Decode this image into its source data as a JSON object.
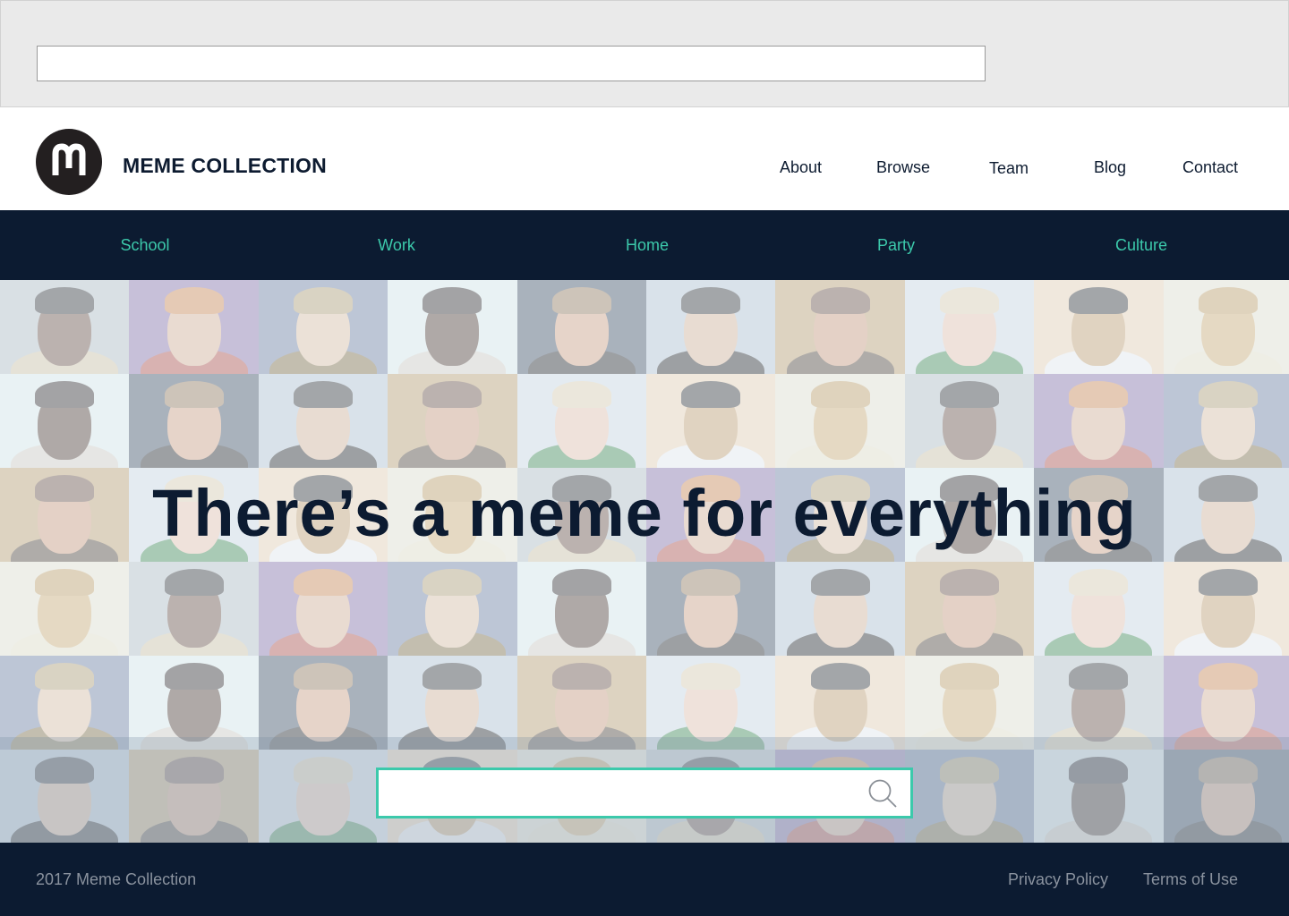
{
  "browser": {
    "address_value": ""
  },
  "header": {
    "brand": "MEME COLLECTION",
    "logo_letter": "M",
    "nav": [
      "About",
      "Browse",
      "Team",
      "Blog",
      "Contact"
    ]
  },
  "categories": [
    "School",
    "Work",
    "Home",
    "Party",
    "Culture"
  ],
  "hero": {
    "headline": "There’s a meme for everything",
    "search_value": "",
    "search_icon": "search-icon"
  },
  "footer": {
    "copyright": "2017 Meme Collection",
    "links": [
      "Privacy Policy",
      "Terms of Use"
    ]
  },
  "colors": {
    "navy": "#0c1b31",
    "accent": "#3cc9ab",
    "footer_text": "#8a929e"
  }
}
